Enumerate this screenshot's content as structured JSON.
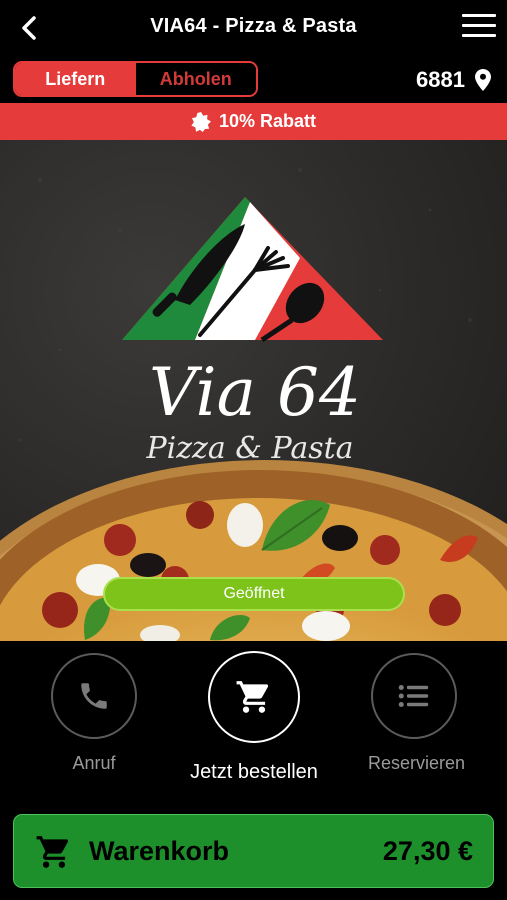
{
  "header": {
    "title": "VIA64 - Pizza & Pasta",
    "back_icon": "chevron-left-icon",
    "menu_icon": "hamburger-menu-icon"
  },
  "mode": {
    "delivery_label": "Liefern",
    "pickup_label": "Abholen",
    "selected": "Liefern",
    "postcode": "6881",
    "location_icon": "map-pin-icon"
  },
  "discount": {
    "icon": "badge-star-icon",
    "label": "10% Rabatt"
  },
  "hero": {
    "logo_name": "Via 64",
    "logo_tagline": "Pizza & Pasta",
    "status": "Geöffnet",
    "logo_colors": [
      "#1f8a3b",
      "#ffffff",
      "#e53b3b"
    ]
  },
  "actions": {
    "call_label": "Anruf",
    "order_label": "Jetzt bestellen",
    "reserve_label": "Reservieren",
    "call_icon": "phone-icon",
    "order_icon": "shopping-cart-icon",
    "reserve_icon": "list-icon"
  },
  "cart": {
    "label": "Warenkorb",
    "total": "27,30 €",
    "icon": "shopping-cart-icon"
  },
  "colors": {
    "accent": "#e53b3b",
    "open_green": "#7dc31a",
    "cart_green": "#1d8f2b"
  }
}
